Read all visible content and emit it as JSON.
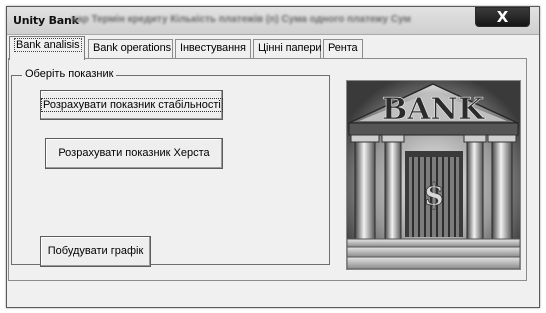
{
  "window": {
    "title": "Unity Bank",
    "title_extra": "нар Термін кредиту  Кількість платежів (n)  Сума одного платежу  Сум",
    "close_label": "X"
  },
  "tabs": [
    {
      "label": "Bank analisis",
      "active": true
    },
    {
      "label": "Bank operations",
      "active": false
    },
    {
      "label": "Інвестування",
      "active": false
    },
    {
      "label": "Цінні папери",
      "active": false
    },
    {
      "label": "Рента",
      "active": false
    }
  ],
  "group": {
    "legend": "Оберіть показник"
  },
  "buttons": {
    "stability": "Розрахувати показник стабільності",
    "hersta": "Розрахувати показник Херста",
    "chart": "Побудувати графік"
  },
  "image": {
    "bank_text": "BANK",
    "currency_symbol": "$"
  }
}
